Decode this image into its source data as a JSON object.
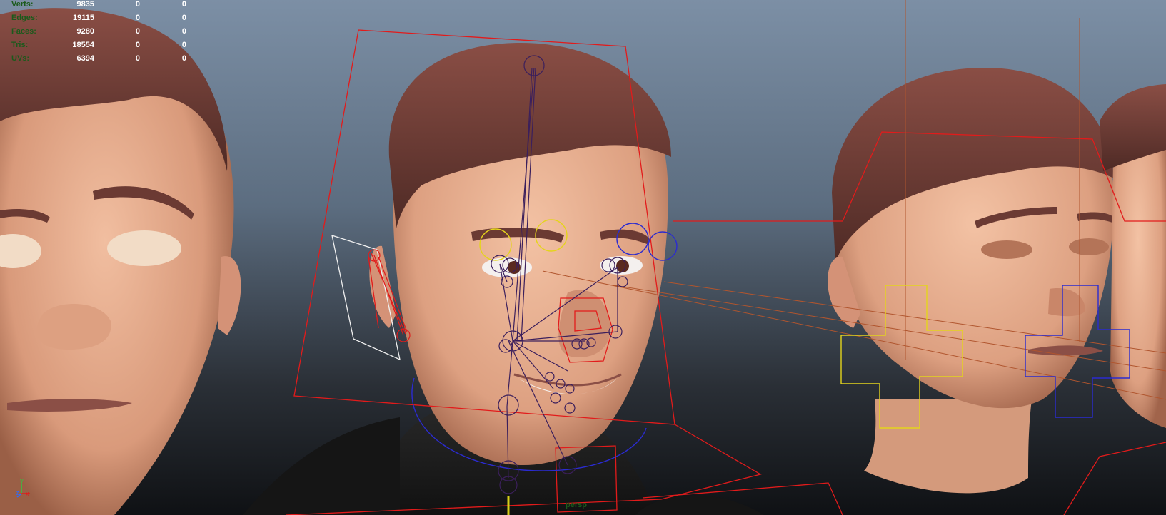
{
  "hud": {
    "rows": [
      {
        "label": "Verts:",
        "v1": "9835",
        "v2": "0",
        "v3": "0"
      },
      {
        "label": "Edges:",
        "v1": "19115",
        "v2": "0",
        "v3": "0"
      },
      {
        "label": "Faces:",
        "v1": "9280",
        "v2": "0",
        "v3": "0"
      },
      {
        "label": "Tris:",
        "v1": "18554",
        "v2": "0",
        "v3": "0"
      },
      {
        "label": "UVs:",
        "v1": "6394",
        "v2": "0",
        "v3": "0"
      }
    ]
  },
  "camera_label": "persp",
  "axis": {
    "y": "y",
    "z": "z",
    "x": "x"
  },
  "colors": {
    "skin": "#e3a98a",
    "hair": "#6b3a33",
    "joint": "#3b1f5c",
    "control_red": "#e21b1b",
    "control_yellow": "#e4d41c",
    "control_blue": "#2b2bd0",
    "hud_label": "#1b5a1b"
  }
}
